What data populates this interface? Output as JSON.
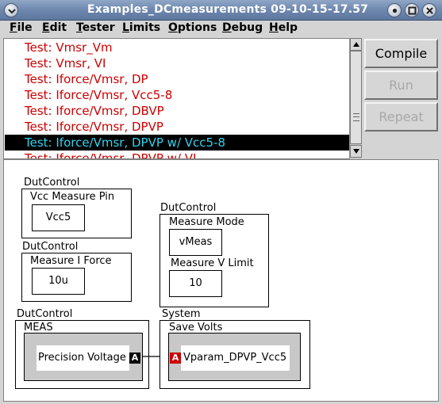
{
  "window": {
    "title": "Examples_DCmeasurements 09-10-15-17.57",
    "menu_icon": "chevron-down-icon",
    "controls": [
      "close-icon",
      "minimize-icon",
      "maximize-icon"
    ]
  },
  "menu": {
    "items": [
      {
        "underline": "F",
        "rest": "ile"
      },
      {
        "underline": "E",
        "rest": "dit"
      },
      {
        "underline": "T",
        "rest": "ester"
      },
      {
        "underline": "L",
        "rest": "imits"
      },
      {
        "underline": "O",
        "rest": "ptions"
      },
      {
        "underline": "D",
        "rest": "ebug"
      },
      {
        "underline": "H",
        "rest": "elp"
      }
    ]
  },
  "tests": {
    "items": [
      "Test: Vmsr_Vm",
      "Test: Vmsr, VI",
      "Test: Iforce/Vmsr, DP",
      "Test: Iforce/Vmsr, Vcc5-8",
      "Test: Iforce/Vmsr, DBVP",
      "Test: Iforce/Vmsr, DPVP",
      "Test: Iforce/Vmsr, DPVP w/ Vcc5-8",
      "Test: Iforce/Vmsr, DPVP w/ VI"
    ],
    "selected_index": 6,
    "colors": {
      "normal": "#cc0000",
      "selected_fg": "#33d2ee",
      "selected_bg": "#000000"
    }
  },
  "buttons": {
    "compile": "Compile",
    "run": "Run",
    "repeat": "Repeat"
  },
  "canvas": {
    "dut1": {
      "group": "DutControl",
      "title": "Vcc Measure Pin",
      "value": "Vcc5"
    },
    "dut2": {
      "group": "DutControl",
      "title": "Measure I Force",
      "value": "10u"
    },
    "dut3": {
      "group": "DutControl",
      "title1": "Measure Mode",
      "value1": "vMeas",
      "title2": "Measure V Limit",
      "value2": "10"
    },
    "meas": {
      "group": "DutControl",
      "title": "MEAS",
      "label": "Precision Voltage",
      "pin": "A"
    },
    "save": {
      "group": "System",
      "title": "Save  Volts",
      "label": "Vparam_DPVP_Vcc5",
      "pin": "A"
    }
  }
}
